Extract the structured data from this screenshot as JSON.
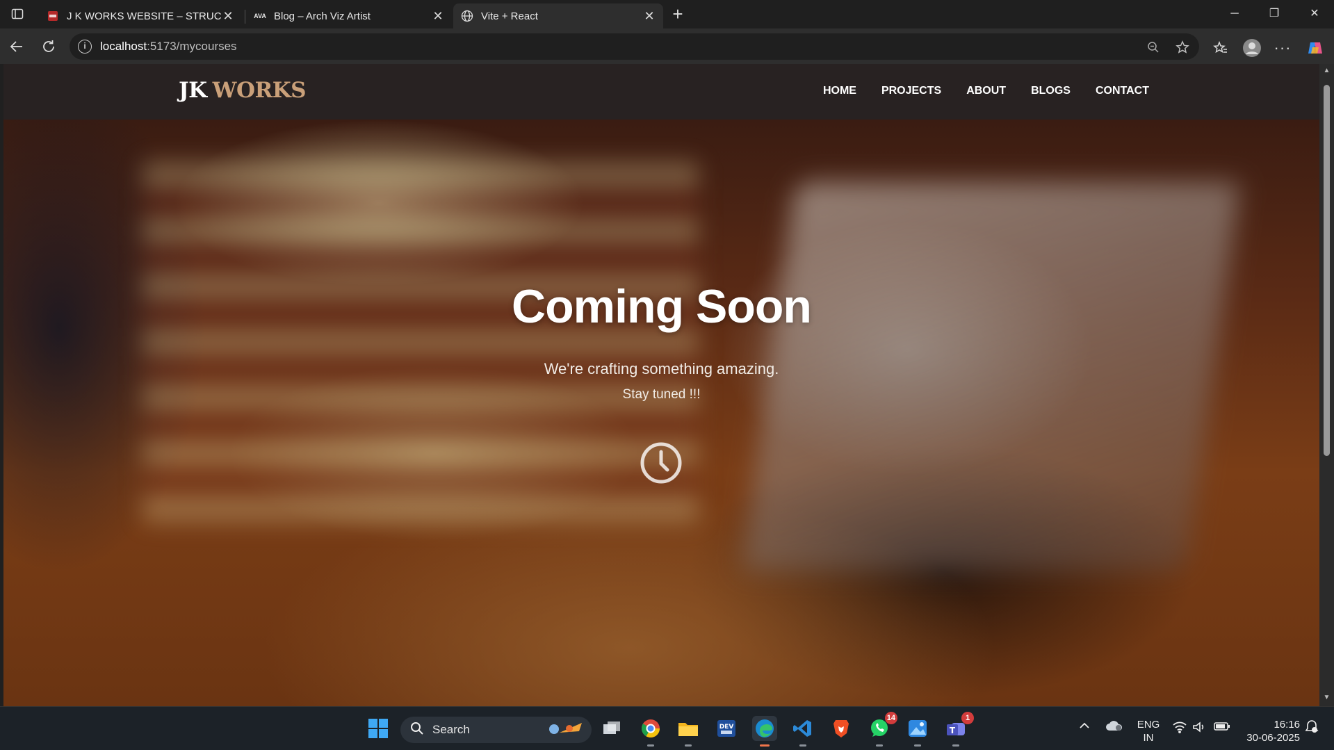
{
  "browser": {
    "tabs": [
      {
        "title": "J K WORKS WEBSITE – STRUCTUR",
        "favicon": "pdf-icon",
        "active": false
      },
      {
        "title": "Blog – Arch Viz Artist",
        "favicon": "ava-icon",
        "favicon_text": "AVA",
        "active": false
      },
      {
        "title": "Vite + React",
        "favicon": "globe-icon",
        "active": true
      }
    ],
    "address": {
      "host": "localhost",
      "path": ":5173/mycourses"
    }
  },
  "site": {
    "logo_part1": "JK",
    "logo_part2": "WORKS",
    "brand_color": "#caa079",
    "nav": [
      "HOME",
      "PROJECTS",
      "ABOUT",
      "BLOGS",
      "CONTACT"
    ],
    "hero": {
      "title": "Coming Soon",
      "subtitle": "We're crafting something amazing.",
      "tagline": "Stay tuned !!!",
      "icon": "clock-icon"
    }
  },
  "taskbar": {
    "search_placeholder": "Search",
    "apps": [
      {
        "name": "task-view",
        "badge": ""
      },
      {
        "name": "chrome",
        "badge": ""
      },
      {
        "name": "file-explorer",
        "badge": ""
      },
      {
        "name": "dev-home",
        "badge": ""
      },
      {
        "name": "edge",
        "badge": ""
      },
      {
        "name": "vscode",
        "badge": ""
      },
      {
        "name": "brave",
        "badge": ""
      },
      {
        "name": "whatsapp",
        "badge": "14"
      },
      {
        "name": "photos",
        "badge": ""
      },
      {
        "name": "teams",
        "badge": "1"
      }
    ],
    "lang_top": "ENG",
    "lang_bottom": "IN",
    "time": "16:16",
    "date": "30-06-2025"
  }
}
